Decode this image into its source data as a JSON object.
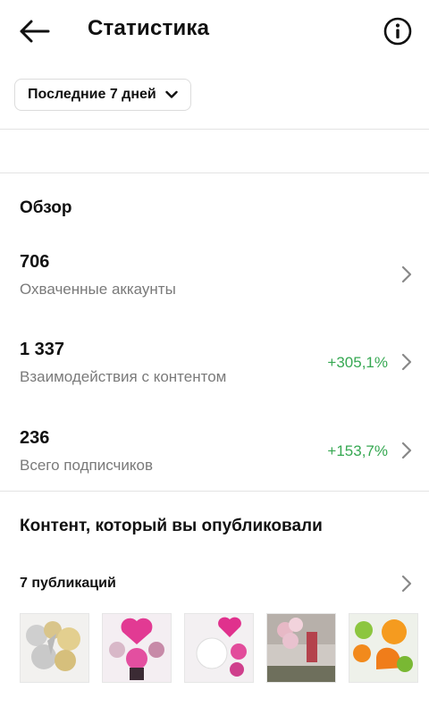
{
  "header": {
    "title": "Статистика"
  },
  "filter": {
    "label": "Последние 7 дней"
  },
  "overview": {
    "title": "Обзор",
    "metrics": [
      {
        "value": "706",
        "label": "Охваченные аккаунты",
        "delta": ""
      },
      {
        "value": "1 337",
        "label": "Взаимодействия с контентом",
        "delta": "+305,1%"
      },
      {
        "value": "236",
        "label": "Всего подписчиков",
        "delta": "+153,7%"
      }
    ]
  },
  "content": {
    "title": "Контент, который вы опубликовали",
    "posts_label": "7 публикаций"
  },
  "colors": {
    "positive": "#36a852",
    "muted": "#7a7a7a"
  },
  "icons": [
    "back-arrow-icon",
    "info-icon",
    "chevron-down-icon",
    "chevron-right-icon"
  ]
}
